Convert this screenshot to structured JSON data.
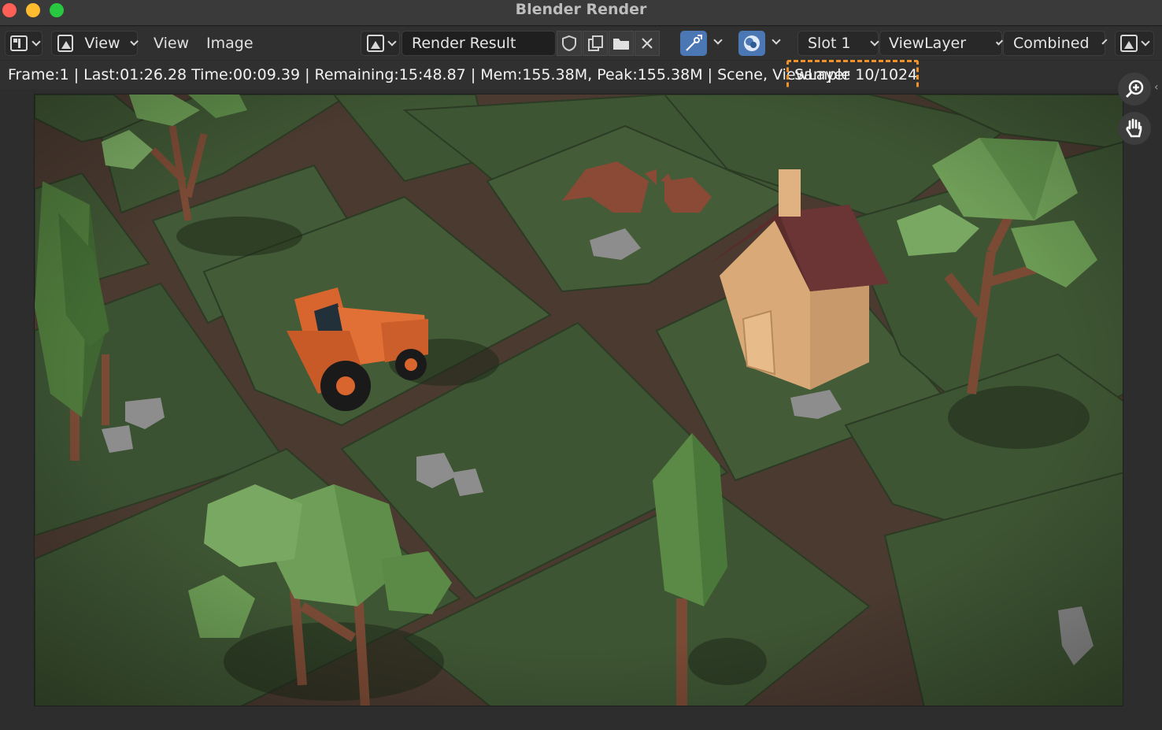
{
  "window": {
    "title": "Blender Render"
  },
  "header": {
    "view_menu_selector_label": "View",
    "view_menu_label": "View",
    "image_menu_label": "Image",
    "image_name": "Render Result",
    "slot_label": "Slot 1",
    "view_layer_label": "ViewLayer",
    "pass_label": "Combined"
  },
  "status": {
    "info": "Frame:1 | Last:01:26.28 Time:00:09.39 | Remaining:15:48.87 | Mem:155.38M, Peak:155.38M | Scene, ViewLayer",
    "sample": "Sample 10/1024"
  },
  "highlight_color": "#f0922a",
  "icons": [
    "editor-type-icon",
    "image-icon",
    "fake-user-shield-icon",
    "new-image-icon",
    "open-folder-icon",
    "close-icon",
    "sample-pick-icon",
    "display-channels-icon",
    "zoom-icon",
    "hand-pan-icon"
  ]
}
